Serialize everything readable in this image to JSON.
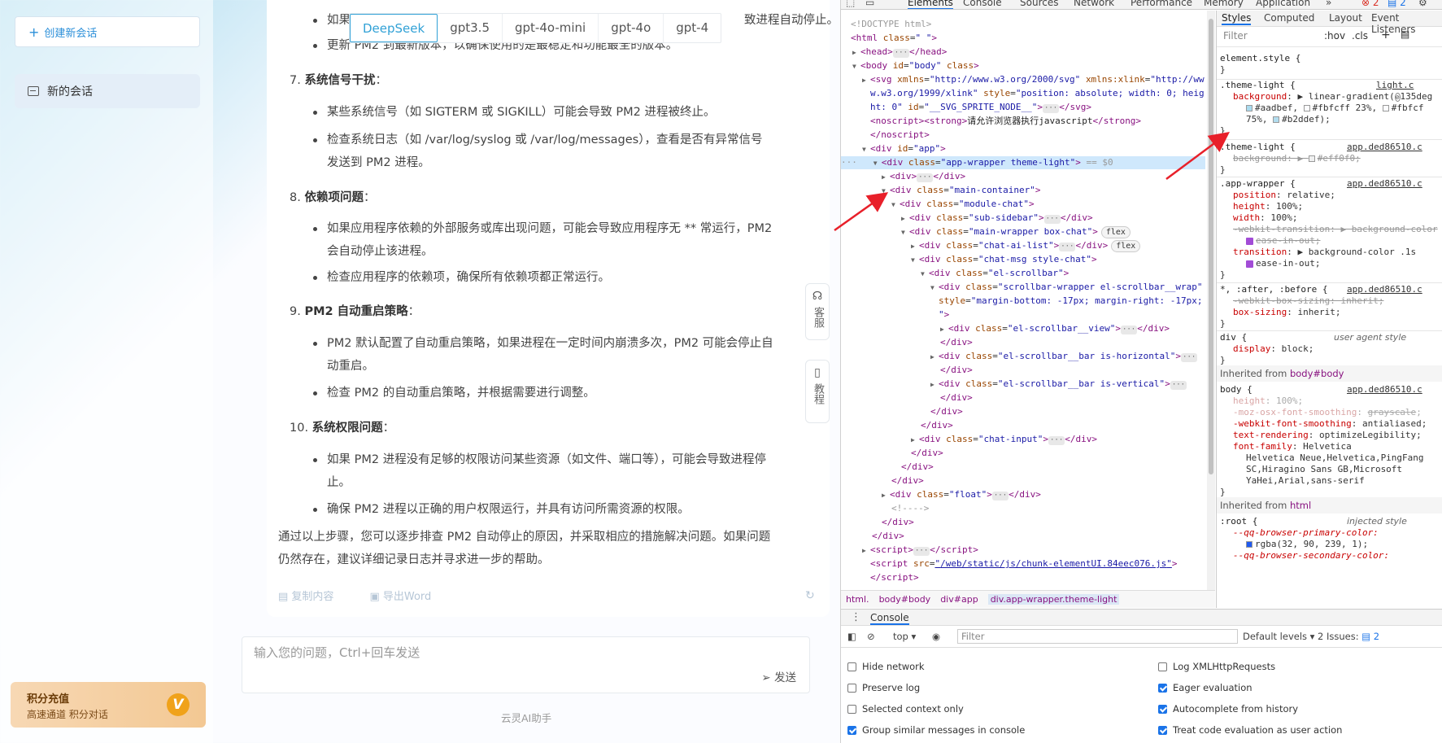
{
  "sidebar": {
    "new_chat_label": "创建新会话",
    "chat_item_label": "新的会话",
    "recharge_title": "积分充值",
    "recharge_sub": "高速通道 积分对话",
    "recharge_badge": "V"
  },
  "model_tabs": [
    "DeepSeek",
    "gpt3.5",
    "gpt-4o-mini",
    "gpt-4o",
    "gpt-4"
  ],
  "active_model": "DeepSeek",
  "article": {
    "line0": "如果",
    "line0_tail": "致进程自动停止。",
    "line1": "更新 PM2 到最新版本，以确保使用的是最稳定和功能最全的版本。",
    "h7_num": "7.",
    "h7": "系统信号干扰",
    "h7_b1": "某些系统信号（如 SIGTERM 或 SIGKILL）可能会导致 PM2 进程被终止。",
    "h7_b2a": "检查系统日志（如 /var/log/syslog 或 /var/log/messages），查看是否有异常信号",
    "h7_b2b": "发送到 PM2 进程。",
    "h8_num": "8.",
    "h8": "依赖项问题",
    "h8_b1a": "如果应用程序依赖的外部服务或库出现问题，可能会导致应用程序无 ** 常运行，PM2",
    "h8_b1b": "会自动停止该进程。",
    "h8_b2": "检查应用程序的依赖项，确保所有依赖项都正常运行。",
    "h9_num": "9.",
    "h9": "PM2 自动重启策略",
    "h9_b1a": "PM2 默认配置了自动重启策略，如果进程在一定时间内崩溃多次，PM2 可能会停止自",
    "h9_b1b": "动重启。",
    "h9_b2": "检查 PM2 的自动重启策略，并根据需要进行调整。",
    "h10_num": "10.",
    "h10": "系统权限问题",
    "h10_b1a": "如果 PM2 进程没有足够的权限访问某些资源（如文件、端口等），可能会导致进程停",
    "h10_b1b": "止。",
    "h10_b2": "确保 PM2 进程以正确的用户权限运行，并具有访问所需资源的权限。",
    "summary_a": "通过以上步骤，您可以逐步排查 PM2 自动停止的原因，并采取相应的措施解决问题。如果问题",
    "summary_b": "仍然存在，建议详细记录日志并寻求进一步的帮助。",
    "colon": "："
  },
  "actions": {
    "copy": "复制内容",
    "export": "导出Word"
  },
  "float": {
    "service": "客服",
    "tutorial": "教程"
  },
  "input": {
    "placeholder": "输入您的问题，Ctrl+回车发送",
    "send": "发送"
  },
  "footer": "云灵AI助手",
  "devtools": {
    "tabs": [
      "Elements",
      "Console",
      "Sources",
      "Network",
      "Performance",
      "Memory",
      "Application"
    ],
    "err_count": "2",
    "info_count": "2",
    "breadcrumbs": [
      "html.",
      "body#body",
      "div#app",
      "div.app-wrapper.theme-light"
    ],
    "styles_tabs": [
      "Styles",
      "Computed",
      "Layout",
      "Event Listeners"
    ],
    "filter_placeholder": "Filter",
    "hov": ":hov",
    "cls": ".cls",
    "console_label": "Console",
    "console_context": "top",
    "console_filter": "Filter",
    "default_levels": "Default levels",
    "issues": "2 Issues:",
    "issues_count": "2",
    "options_left": [
      {
        "label": "Hide network",
        "checked": false
      },
      {
        "label": "Preserve log",
        "checked": false
      },
      {
        "label": "Selected context only",
        "checked": false
      },
      {
        "label": "Group similar messages in console",
        "checked": true
      }
    ],
    "options_right": [
      {
        "label": "Log XMLHttpRequests",
        "checked": false
      },
      {
        "label": "Eager evaluation",
        "checked": true
      },
      {
        "label": "Autocomplete from history",
        "checked": true
      },
      {
        "label": "Treat code evaluation as user action",
        "checked": true
      }
    ],
    "dom": {
      "doctype": "<!DOCTYPE html>",
      "noscript_text": "请允许浏览器执行javascript",
      "sprite_id": "__SVG_SPRITE_NODE__",
      "script_src": "/web/static/js/chunk-elementUI.84eec076.js",
      "selected_marker": "== $0"
    },
    "styles": {
      "element_style": "element.style {",
      "theme_light_src": "light.c",
      "app_src": "app.ded86510.c",
      "grad_angle": "135deg",
      "c1": "#aadbef",
      "c2": "#fbfcff",
      "c2_pos": "23%",
      "c3_pos": "75%",
      "c4": "#b2ddef",
      "strike_bg": "#eff0f0",
      "inherited_body": "body#body",
      "inherited_html": "html",
      "user_agent": "user agent style",
      "injected": "injected style",
      "font_family": "Helvetica Neue,Helvetica,PingFang SC,Hiragino Sans GB,Microsoft YaHei,Arial,sans-serif",
      "root_var1": "--qq-browser-primary-color:",
      "root_var1_val": "rgba(32, 90, 239, 1);",
      "root_var2": "--qq-browser-secondary-color:"
    }
  },
  "colors": {
    "accent": "#31a1d6",
    "arrow": "#e8202a",
    "recharge_badge": "#f0a21a"
  }
}
